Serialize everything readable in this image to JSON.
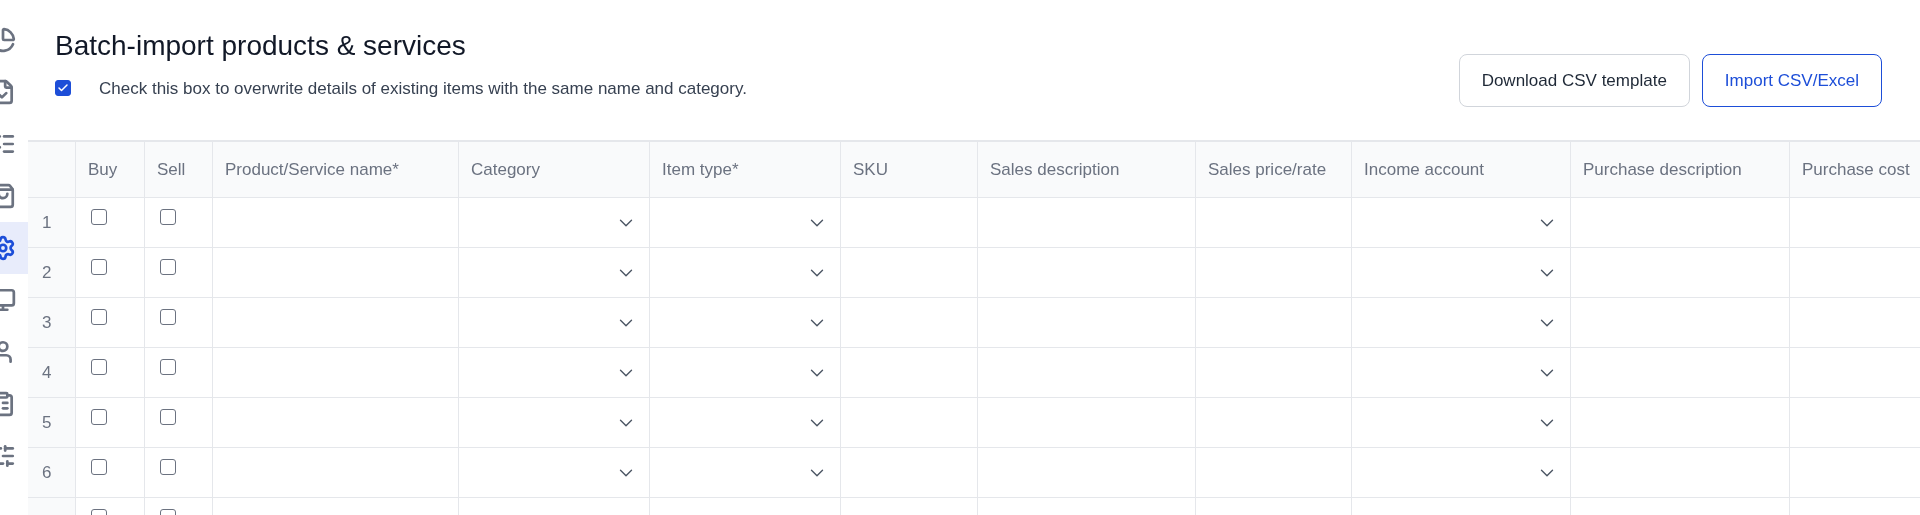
{
  "sidebar": {
    "items": [
      {
        "selected": false
      },
      {
        "selected": false
      },
      {
        "selected": false
      },
      {
        "selected": false
      },
      {
        "selected": true
      },
      {
        "selected": false
      },
      {
        "selected": false
      },
      {
        "selected": false
      },
      {
        "selected": false
      }
    ]
  },
  "title": "Batch-import products & services",
  "overwrite": {
    "label": "Check this box to overwrite details of existing items with the same name and category.",
    "checked": true
  },
  "buttons": [
    {
      "label": "Download CSV template",
      "kind": "secondary"
    },
    {
      "label": "Import CSV/Excel",
      "kind": "primary"
    }
  ],
  "table": {
    "columns": [
      {
        "label": "Buy",
        "kind": "check"
      },
      {
        "label": "Sell",
        "kind": "check"
      },
      {
        "label": "Product/Service name*",
        "kind": "text"
      },
      {
        "label": "Category",
        "kind": "select"
      },
      {
        "label": "Item type*",
        "kind": "select"
      },
      {
        "label": "SKU",
        "kind": "text"
      },
      {
        "label": "Sales description",
        "kind": "text"
      },
      {
        "label": "Sales price/rate",
        "kind": "text"
      },
      {
        "label": "Income account",
        "kind": "select"
      },
      {
        "label": "Purchase description",
        "kind": "text"
      },
      {
        "label": "Purchase cost",
        "kind": "text"
      }
    ],
    "rows": [
      {
        "number": "1",
        "buy": false,
        "sell": false
      },
      {
        "number": "2",
        "buy": false,
        "sell": false
      },
      {
        "number": "3",
        "buy": false,
        "sell": false
      },
      {
        "number": "4",
        "buy": false,
        "sell": false
      },
      {
        "number": "5",
        "buy": false,
        "sell": false
      },
      {
        "number": "6",
        "buy": false,
        "sell": false
      },
      {
        "buy": false,
        "sell": false
      }
    ]
  }
}
